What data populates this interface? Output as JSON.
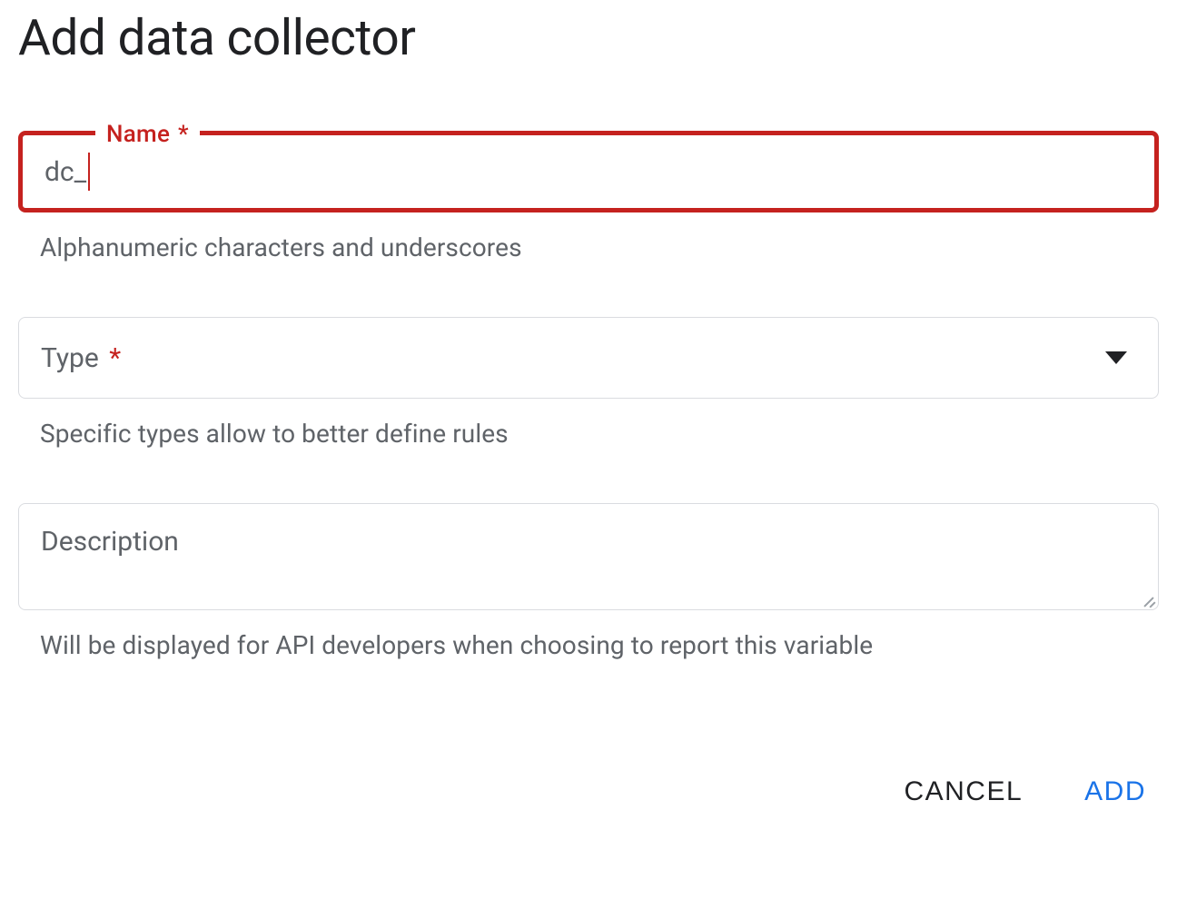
{
  "dialog": {
    "title": "Add data collector"
  },
  "name_field": {
    "label": "Name",
    "required_mark": "*",
    "prefix": "dc_",
    "value": "",
    "helper": "Alphanumeric characters and underscores"
  },
  "type_field": {
    "label": "Type",
    "required_mark": "*",
    "helper": "Specific types allow to better define rules"
  },
  "description_field": {
    "label": "Description",
    "helper": "Will be displayed for API developers when choosing to report this variable"
  },
  "buttons": {
    "cancel": "CANCEL",
    "add": "ADD"
  },
  "colors": {
    "error": "#c5221f",
    "primary": "#1a73e8",
    "text_secondary": "#5f6368",
    "border": "#dadce0"
  }
}
